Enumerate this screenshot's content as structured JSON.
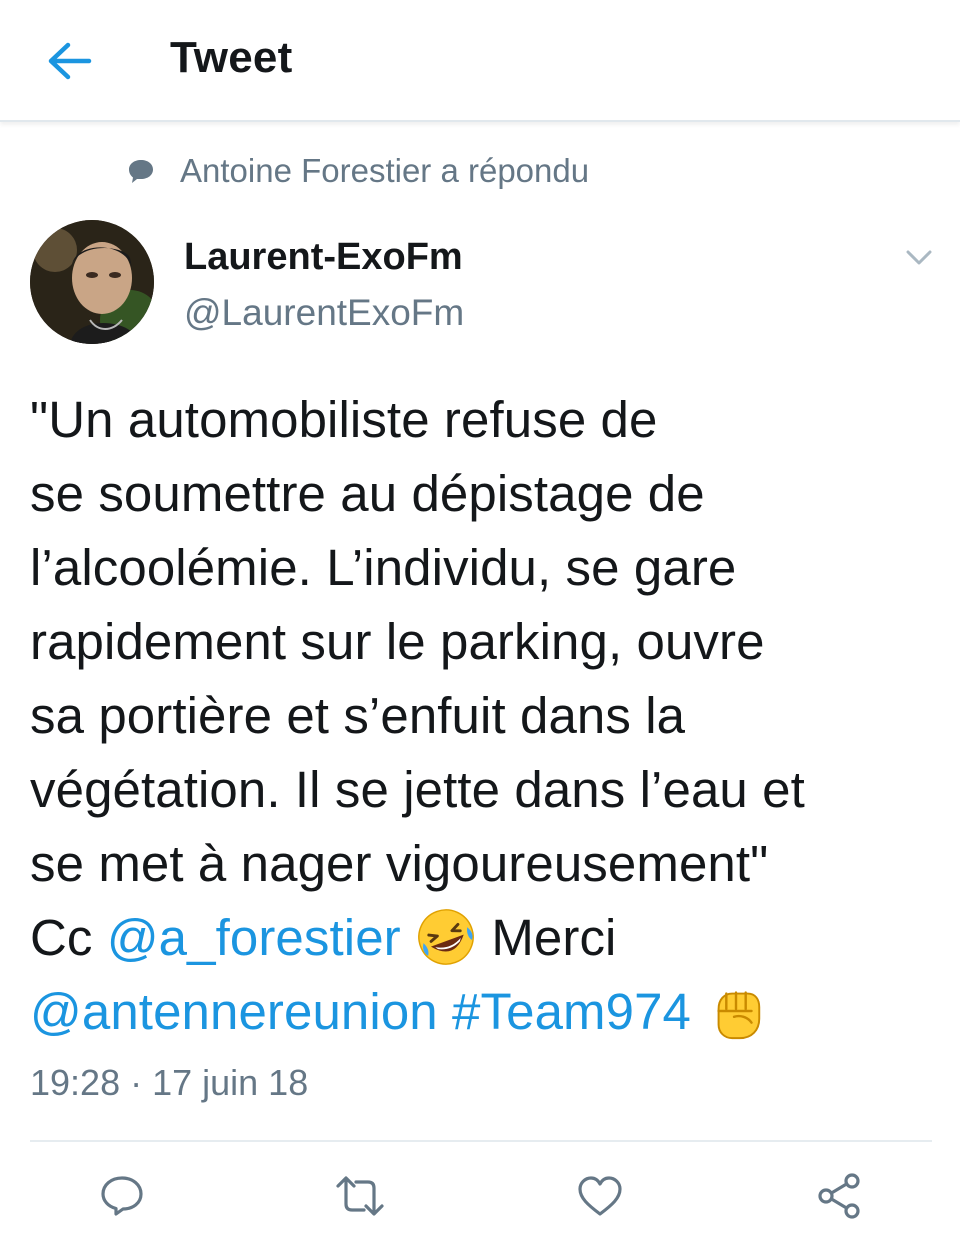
{
  "header": {
    "title": "Tweet",
    "back_icon": "arrow-left-icon"
  },
  "context": {
    "text": "Antoine Forestier a répondu",
    "icon": "speech-bubble-icon"
  },
  "author": {
    "name": "Laurent-ExoFm",
    "handle": "@LaurentExoFm"
  },
  "tweet": {
    "lines": [
      "\"Un automobiliste refuse de",
      "se soumettre au dépistage de",
      "l’alcoolémie. L’individu, se gare",
      "rapidement sur le parking, ouvre",
      "sa portière et s’enfuit dans la",
      "végétation. Il se jette dans l’eau et",
      "se met à nager vigoureusement\""
    ],
    "cc_prefix": "Cc",
    "mention_1": "@a_forestier",
    "merci": "Merci",
    "mention_2": "@antennereunion",
    "hashtag": "#Team974",
    "emoji_1": "rolling-on-floor-laughing-emoji",
    "emoji_2": "raised-fist-emoji"
  },
  "timestamp": "19:28 · 17 juin 18",
  "colors": {
    "accent": "#1b95e0",
    "secondary_text": "#657786",
    "primary_text": "#14171a"
  },
  "actions": [
    "reply-icon",
    "retweet-icon",
    "like-icon",
    "share-icon"
  ]
}
